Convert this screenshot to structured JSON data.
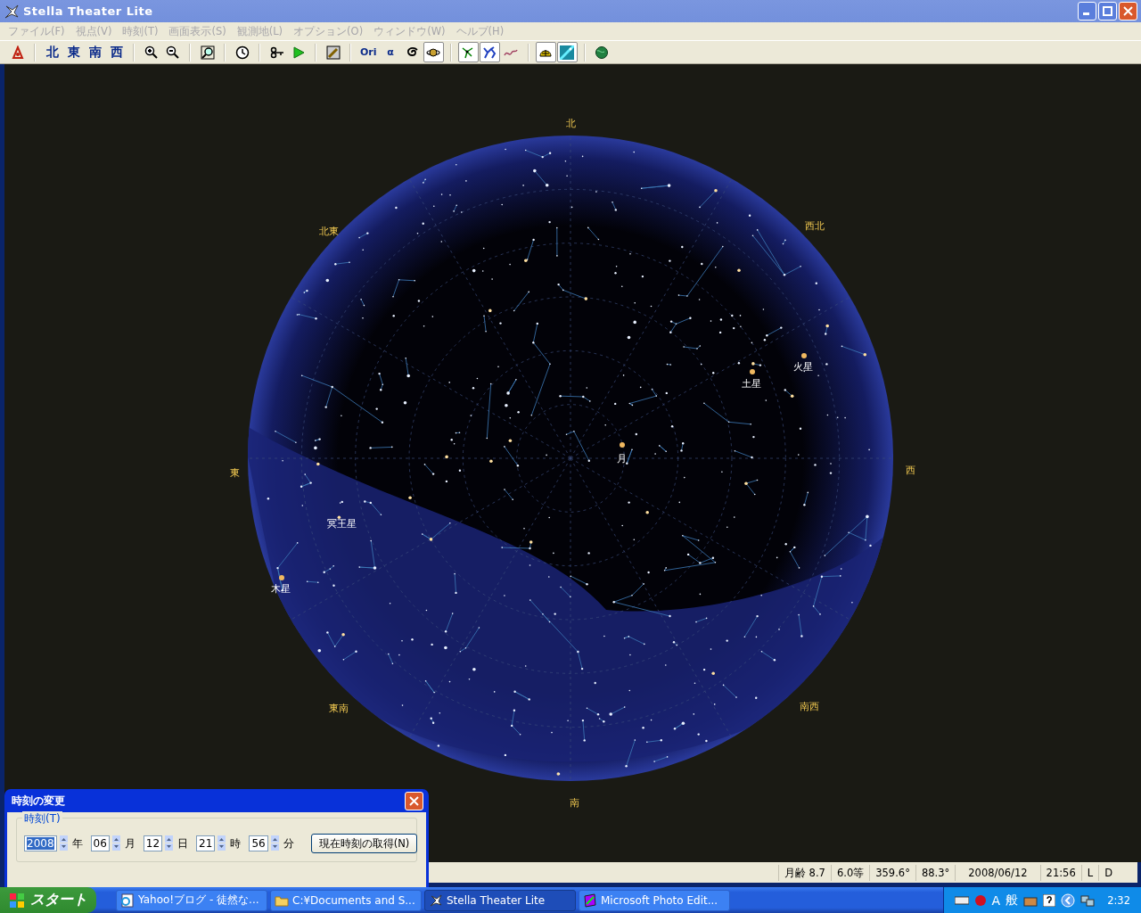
{
  "window": {
    "title": "Stella Theater Lite"
  },
  "menu": [
    {
      "label": "ファイル(F)",
      "disabled": true
    },
    {
      "label": "視点(V)",
      "disabled": true
    },
    {
      "label": "時刻(T)",
      "disabled": true
    },
    {
      "label": "画面表示(S)",
      "disabled": true
    },
    {
      "label": "観測地(L)",
      "disabled": true
    },
    {
      "label": "オプション(O)",
      "disabled": true
    },
    {
      "label": "ウィンドウ(W)",
      "disabled": true
    },
    {
      "label": "ヘルプ(H)",
      "disabled": true
    }
  ],
  "toolbar": [
    {
      "kind": "icon",
      "pressed": false
    },
    {
      "kind": "separator"
    },
    {
      "kind": "text",
      "label": "北",
      "pressed": false
    },
    {
      "kind": "text",
      "label": "東",
      "pressed": false
    },
    {
      "kind": "text",
      "label": "南",
      "pressed": false
    },
    {
      "kind": "text",
      "label": "西",
      "pressed": false
    },
    {
      "kind": "separator"
    },
    {
      "kind": "icon",
      "pressed": false
    },
    {
      "kind": "icon",
      "pressed": false
    },
    {
      "kind": "separator"
    },
    {
      "kind": "icon",
      "pressed": false
    },
    {
      "kind": "separator"
    },
    {
      "kind": "icon",
      "pressed": false
    },
    {
      "kind": "separator"
    },
    {
      "kind": "icon",
      "pressed": false
    },
    {
      "kind": "icon",
      "pressed": false
    },
    {
      "kind": "separator"
    },
    {
      "kind": "icon",
      "pressed": false
    },
    {
      "kind": "separator"
    },
    {
      "kind": "small",
      "label": "Ori",
      "pressed": false
    },
    {
      "kind": "small",
      "label": "α",
      "pressed": false
    },
    {
      "kind": "icon",
      "pressed": false
    },
    {
      "kind": "icon",
      "pressed": true
    },
    {
      "kind": "separator"
    },
    {
      "kind": "icon",
      "pressed": true
    },
    {
      "kind": "icon",
      "pressed": true
    },
    {
      "kind": "icon",
      "pressed": false
    },
    {
      "kind": "separator"
    },
    {
      "kind": "icon",
      "pressed": true
    },
    {
      "kind": "icon",
      "pressed": true
    },
    {
      "kind": "separator"
    },
    {
      "kind": "icon",
      "pressed": false
    }
  ],
  "sky": {
    "directions": [
      "北",
      "北東",
      "西北",
      "東",
      "西",
      "東南",
      "南西",
      "南"
    ],
    "bodies": [
      {
        "label": "火星"
      },
      {
        "label": "土星"
      },
      {
        "label": "月"
      },
      {
        "label": "冥王星"
      },
      {
        "label": "木星"
      }
    ]
  },
  "status_bar": [
    "月齢 8.7",
    "6.0等",
    "359.6°",
    "88.3°",
    "2008/06/12",
    "21:56",
    "L",
    "D"
  ],
  "dialog": {
    "title": "時刻の変更",
    "group": "時刻(T)",
    "fields": [
      {
        "value": "2008",
        "unit": "年",
        "selected": true
      },
      {
        "value": "06",
        "unit": "月",
        "selected": false
      },
      {
        "value": "12",
        "unit": "日",
        "selected": false
      },
      {
        "value": "21",
        "unit": "時",
        "selected": false
      },
      {
        "value": "56",
        "unit": "分",
        "selected": false
      }
    ],
    "button": "現在時刻の取得(N)"
  },
  "taskbar": {
    "start": "スタート",
    "tasks": [
      {
        "label": "Yahoo!ブログ - 徒然な...",
        "selected": false
      },
      {
        "label": "C:¥Documents and S...",
        "selected": false
      },
      {
        "label": "Stella Theater Lite",
        "selected": true
      },
      {
        "label": "Microsoft Photo Edit...",
        "selected": false
      }
    ],
    "tray": [
      "A",
      "般"
    ],
    "clock": "2:32"
  }
}
